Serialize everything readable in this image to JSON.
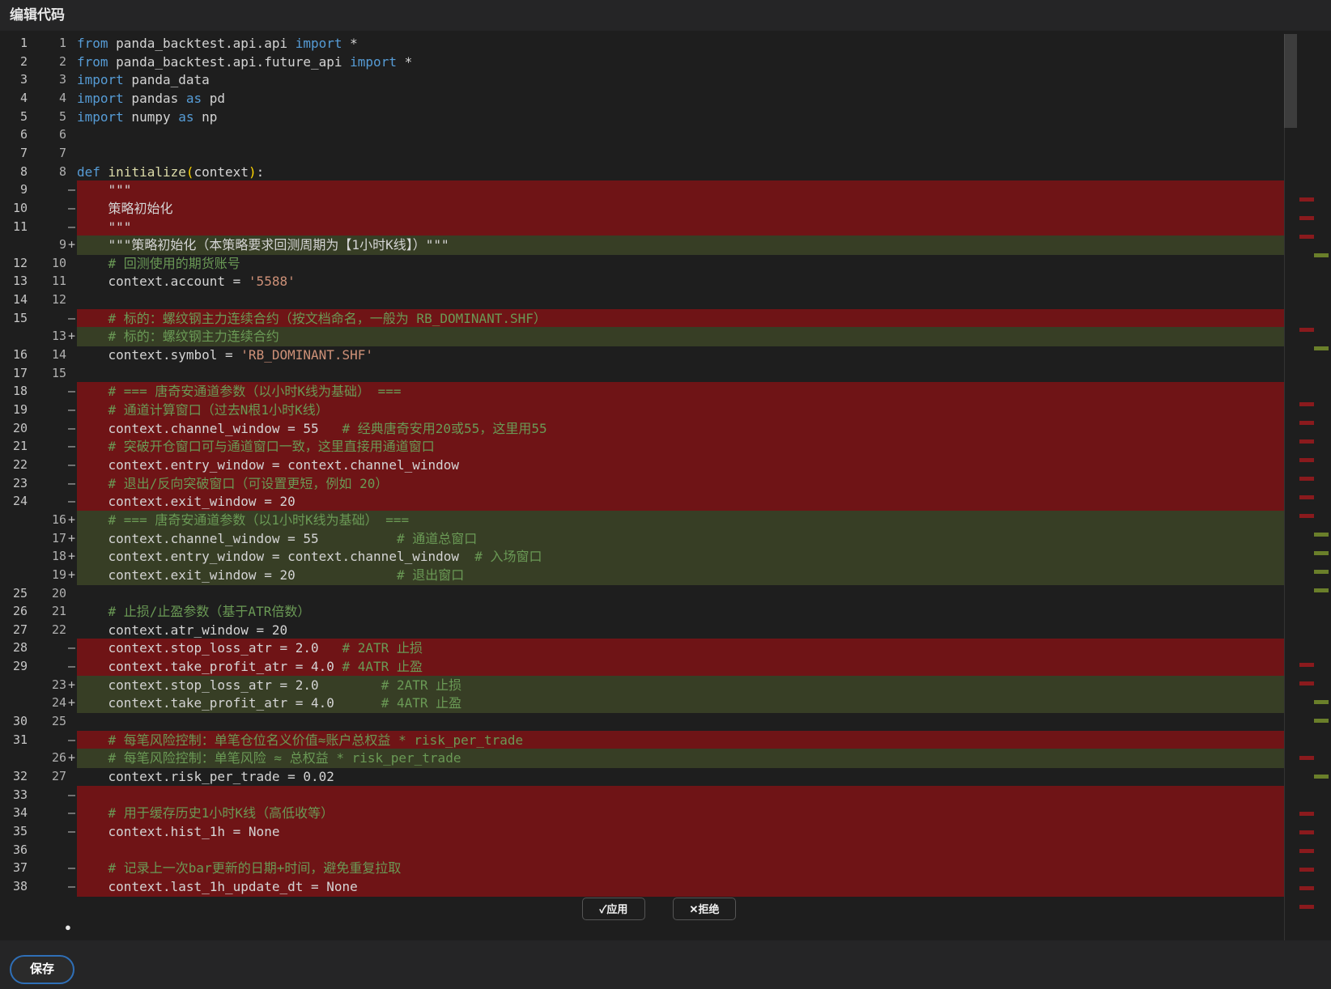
{
  "window": {
    "title": "编辑代码"
  },
  "footer": {
    "save_label": "保存"
  },
  "actions": {
    "apply_label": "✓应用",
    "reject_label": "✕拒绝"
  },
  "colors": {
    "deleted_line_bg": "#6f1416",
    "added_line_bg": "#373e25",
    "keyword": "#569cd6",
    "string": "#ce9178",
    "comment": "#6a9955",
    "save_border": "#2f6fb7"
  },
  "lines": [
    {
      "orig": "1",
      "mod": "1",
      "marker": "",
      "type": "same",
      "code": "from panda_backtest.api.api import *"
    },
    {
      "orig": "2",
      "mod": "2",
      "marker": "",
      "type": "same",
      "code": "from panda_backtest.api.future_api import *"
    },
    {
      "orig": "3",
      "mod": "3",
      "marker": "",
      "type": "same",
      "code": "import panda_data"
    },
    {
      "orig": "4",
      "mod": "4",
      "marker": "",
      "type": "same",
      "code": "import pandas as pd"
    },
    {
      "orig": "5",
      "mod": "5",
      "marker": "",
      "type": "same",
      "code": "import numpy as np"
    },
    {
      "orig": "6",
      "mod": "6",
      "marker": "",
      "type": "same",
      "code": ""
    },
    {
      "orig": "7",
      "mod": "7",
      "marker": "",
      "type": "same",
      "code": ""
    },
    {
      "orig": "8",
      "mod": "8",
      "marker": "",
      "type": "same",
      "code": "def initialize(context):"
    },
    {
      "orig": "9",
      "mod": "",
      "marker": "—",
      "type": "del",
      "code": "    \"\"\""
    },
    {
      "orig": "10",
      "mod": "",
      "marker": "—",
      "type": "del",
      "code": "    策略初始化"
    },
    {
      "orig": "11",
      "mod": "",
      "marker": "—",
      "type": "del",
      "code": "    \"\"\""
    },
    {
      "orig": "",
      "mod": "9",
      "marker": "+",
      "type": "add",
      "code": "    \"\"\"策略初始化（本策略要求回测周期为【1小时K线】）\"\"\""
    },
    {
      "orig": "12",
      "mod": "10",
      "marker": "",
      "type": "same",
      "code": "    # 回测使用的期货账号"
    },
    {
      "orig": "13",
      "mod": "11",
      "marker": "",
      "type": "same",
      "code": "    context.account = '5588'"
    },
    {
      "orig": "14",
      "mod": "12",
      "marker": "",
      "type": "same",
      "code": ""
    },
    {
      "orig": "15",
      "mod": "",
      "marker": "—",
      "type": "del",
      "code": "    # 标的：螺纹钢主力连续合约（按文档命名，一般为 RB_DOMINANT.SHF）"
    },
    {
      "orig": "",
      "mod": "13",
      "marker": "+",
      "type": "add",
      "code": "    # 标的：螺纹钢主力连续合约"
    },
    {
      "orig": "16",
      "mod": "14",
      "marker": "",
      "type": "same",
      "code": "    context.symbol = 'RB_DOMINANT.SHF'"
    },
    {
      "orig": "17",
      "mod": "15",
      "marker": "",
      "type": "same",
      "code": ""
    },
    {
      "orig": "18",
      "mod": "",
      "marker": "—",
      "type": "del",
      "code": "    # === 唐奇安通道参数（以小时K线为基础） ==="
    },
    {
      "orig": "19",
      "mod": "",
      "marker": "—",
      "type": "del",
      "code": "    # 通道计算窗口（过去N根1小时K线）"
    },
    {
      "orig": "20",
      "mod": "",
      "marker": "—",
      "type": "del",
      "code": "    context.channel_window = 55   # 经典唐奇安用20或55，这里用55"
    },
    {
      "orig": "21",
      "mod": "",
      "marker": "—",
      "type": "del",
      "code": "    # 突破开仓窗口可与通道窗口一致，这里直接用通道窗口"
    },
    {
      "orig": "22",
      "mod": "",
      "marker": "—",
      "type": "del",
      "code": "    context.entry_window = context.channel_window"
    },
    {
      "orig": "23",
      "mod": "",
      "marker": "—",
      "type": "del",
      "code": "    # 退出/反向突破窗口（可设置更短，例如 20）"
    },
    {
      "orig": "24",
      "mod": "",
      "marker": "—",
      "type": "del",
      "code": "    context.exit_window = 20"
    },
    {
      "orig": "",
      "mod": "16",
      "marker": "+",
      "type": "add",
      "code": "    # === 唐奇安通道参数（以1小时K线为基础） ==="
    },
    {
      "orig": "",
      "mod": "17",
      "marker": "+",
      "type": "add",
      "code": "    context.channel_window = 55          # 通道总窗口"
    },
    {
      "orig": "",
      "mod": "18",
      "marker": "+",
      "type": "add",
      "code": "    context.entry_window = context.channel_window  # 入场窗口"
    },
    {
      "orig": "",
      "mod": "19",
      "marker": "+",
      "type": "add",
      "code": "    context.exit_window = 20             # 退出窗口"
    },
    {
      "orig": "25",
      "mod": "20",
      "marker": "",
      "type": "same",
      "code": ""
    },
    {
      "orig": "26",
      "mod": "21",
      "marker": "",
      "type": "same",
      "code": "    # 止损/止盈参数（基于ATR倍数）"
    },
    {
      "orig": "27",
      "mod": "22",
      "marker": "",
      "type": "same",
      "code": "    context.atr_window = 20"
    },
    {
      "orig": "28",
      "mod": "",
      "marker": "—",
      "type": "del",
      "code": "    context.stop_loss_atr = 2.0   # 2ATR 止损"
    },
    {
      "orig": "29",
      "mod": "",
      "marker": "—",
      "type": "del",
      "code": "    context.take_profit_atr = 4.0 # 4ATR 止盈"
    },
    {
      "orig": "",
      "mod": "23",
      "marker": "+",
      "type": "add",
      "code": "    context.stop_loss_atr = 2.0        # 2ATR 止损"
    },
    {
      "orig": "",
      "mod": "24",
      "marker": "+",
      "type": "add",
      "code": "    context.take_profit_atr = 4.0      # 4ATR 止盈"
    },
    {
      "orig": "30",
      "mod": "25",
      "marker": "",
      "type": "same",
      "code": ""
    },
    {
      "orig": "31",
      "mod": "",
      "marker": "—",
      "type": "del",
      "code": "    # 每笔风险控制：单笔仓位名义价值≈账户总权益 * risk_per_trade"
    },
    {
      "orig": "",
      "mod": "26",
      "marker": "+",
      "type": "add",
      "code": "    # 每笔风险控制：单笔风险 ≈ 总权益 * risk_per_trade"
    },
    {
      "orig": "32",
      "mod": "27",
      "marker": "",
      "type": "same",
      "code": "    context.risk_per_trade = 0.02"
    },
    {
      "orig": "33",
      "mod": "",
      "marker": "—",
      "type": "del",
      "code": ""
    },
    {
      "orig": "34",
      "mod": "",
      "marker": "—",
      "type": "del",
      "code": "    # 用于缓存历史1小时K线（高低收等）"
    },
    {
      "orig": "35",
      "mod": "",
      "marker": "—",
      "type": "del",
      "code": "    context.hist_1h = None"
    },
    {
      "orig": "36",
      "mod": "",
      "marker": "",
      "type": "del",
      "code": ""
    },
    {
      "orig": "37",
      "mod": "",
      "marker": "—",
      "type": "del",
      "code": "    # 记录上一次bar更新的日期+时间，避免重复拉取"
    },
    {
      "orig": "38",
      "mod": "",
      "marker": "—",
      "type": "del",
      "code": "    context.last_1h_update_dt = None"
    }
  ]
}
